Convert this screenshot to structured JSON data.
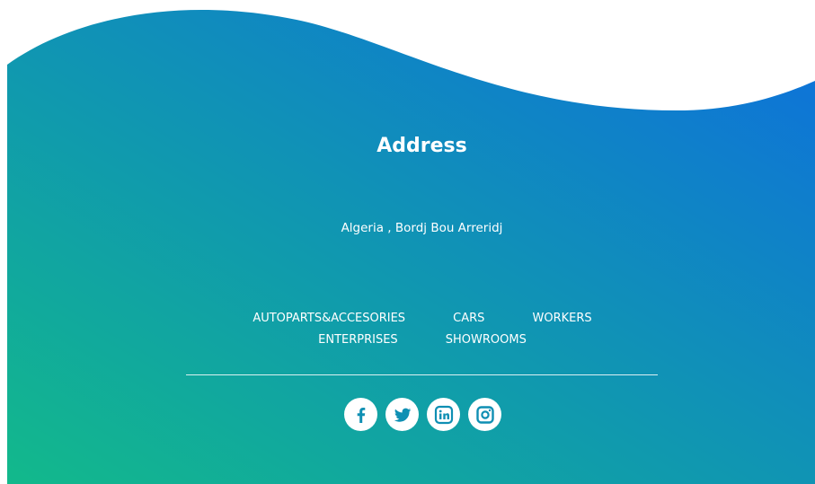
{
  "footer": {
    "address_title": "Address",
    "address_text": "Algeria , Bordj Bou Arreridj",
    "nav": [
      {
        "label": "AUTOPARTS&ACCESORIES"
      },
      {
        "label": "CARS"
      },
      {
        "label": "WORKERS"
      },
      {
        "label": "ENTERPRISES"
      },
      {
        "label": "SHOWROOMS"
      }
    ],
    "social": [
      {
        "icon": "facebook-icon"
      },
      {
        "icon": "twitter-icon"
      },
      {
        "icon": "linkedin-icon"
      },
      {
        "icon": "instagram-icon"
      }
    ]
  },
  "colors": {
    "gradient_start": "#12b98b",
    "gradient_end": "#0e6fdd",
    "text": "#ffffff",
    "icon_bg": "#ffffff"
  }
}
